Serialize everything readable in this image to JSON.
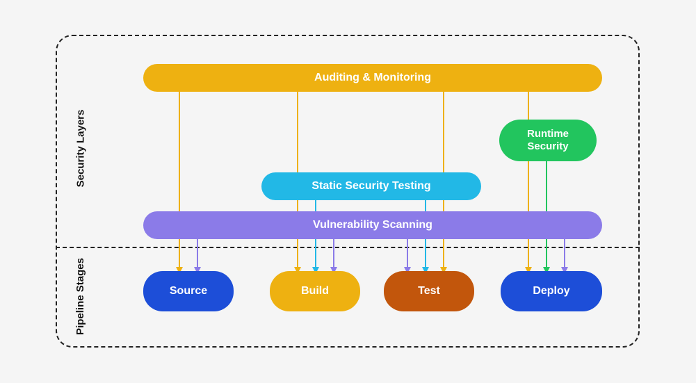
{
  "labels": {
    "security_layers": "Security Layers",
    "pipeline_stages": "Pipeline Stages"
  },
  "layers": {
    "auditing": "Auditing & Monitoring",
    "runtime": "Runtime Security",
    "static": "Static Security Testing",
    "vulnerability": "Vulnerability Scanning"
  },
  "stages": {
    "source": "Source",
    "build": "Build",
    "test": "Test",
    "deploy": "Deploy"
  },
  "colors": {
    "auditing": "#eeb111",
    "runtime": "#22c55e",
    "static": "#22b8e6",
    "vulnerability": "#8B7BE8",
    "source": "#1d4ed8",
    "build": "#eeb111",
    "test": "#c2560c",
    "deploy": "#1d4ed8"
  }
}
